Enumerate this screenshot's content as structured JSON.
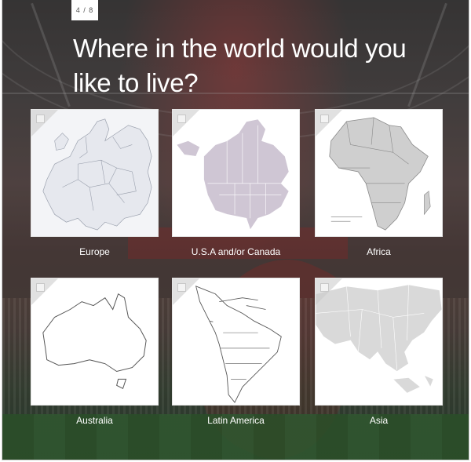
{
  "progress": {
    "text": "4 / 8"
  },
  "question": {
    "text": "Where in the world would you like to live?"
  },
  "options": [
    {
      "label": "Europe",
      "icon": "europe-map-icon"
    },
    {
      "label": "U.S.A and/or Canada",
      "icon": "north-america-map-icon"
    },
    {
      "label": "Africa",
      "icon": "africa-map-icon"
    },
    {
      "label": "Australia",
      "icon": "australia-map-icon"
    },
    {
      "label": "Latin America",
      "icon": "latin-america-map-icon"
    },
    {
      "label": "Asia",
      "icon": "asia-map-icon"
    }
  ],
  "colors": {
    "card_bg": "#ffffff",
    "map_fill_europe": "#e9ebf0",
    "map_fill_na": "#cfc6d4",
    "map_fill_africa": "#cfcfcf",
    "map_fill_asia": "#d9d9d9",
    "outline": "#555555"
  }
}
